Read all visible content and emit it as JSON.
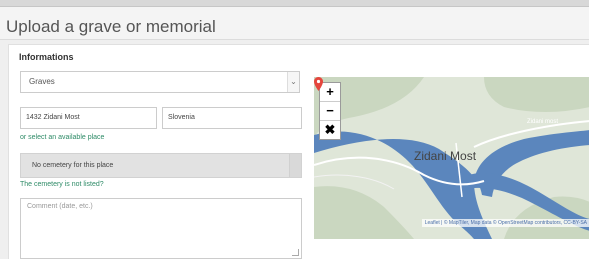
{
  "page": {
    "title": "Upload a grave or memorial"
  },
  "form": {
    "section_title": "Informations",
    "type_select": {
      "value": "Graves"
    },
    "city_input": {
      "value": "1432 Zidani Most"
    },
    "country_input": {
      "value": "Slovenia"
    },
    "select_place_link": "or select an available place",
    "cemetery_select": {
      "value": "No cemetery for this place"
    },
    "cemetery_missing_link": "The cemetery is not listed?",
    "comment": {
      "placeholder": "Comment (date, etc.)"
    }
  },
  "map": {
    "zoom_in": "+",
    "zoom_out": "−",
    "reset": "✖",
    "place_label": "Zidani Most",
    "river_label": "Zidani most",
    "attribution": "Leaflet | © MapTiler, Map data © OpenStreetMap contributors, CC-BY-SA",
    "colors": {
      "river": "#5b86bd",
      "land": "#dfe6d8",
      "forest": "#cad7c0",
      "road": "#ffffff",
      "pin": "#e5463d"
    }
  }
}
